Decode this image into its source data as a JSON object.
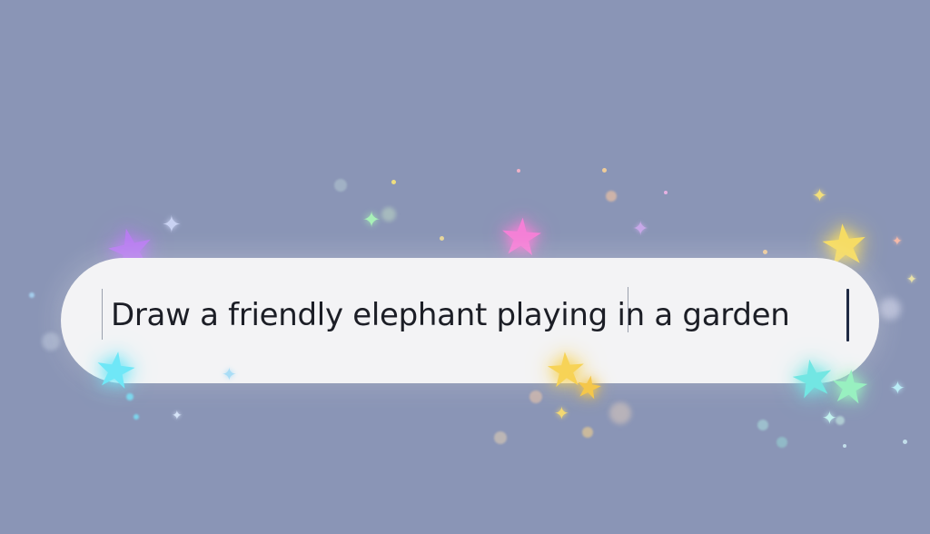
{
  "prompt_input": {
    "value": "Draw a friendly elephant playing in a garden"
  },
  "decorations": {
    "background_color": "#8a95b6",
    "star_icon": "star-icon",
    "sparkle_icon": "sparkle-dot-icon"
  }
}
